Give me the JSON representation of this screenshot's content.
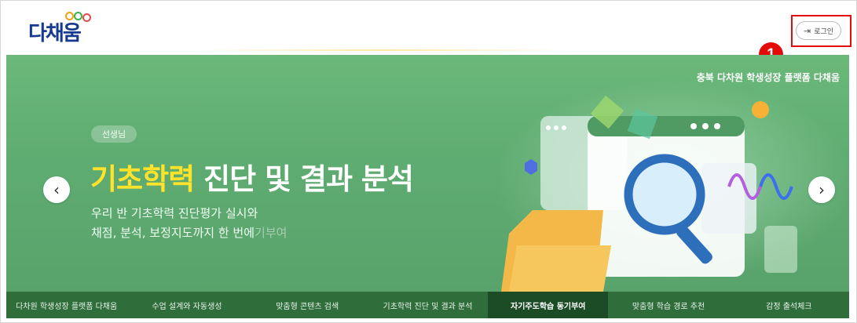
{
  "header": {
    "logo_text": "다채움",
    "login_label": "로그인",
    "login_icon": "login-arrow-icon"
  },
  "annotation": {
    "marker_number": "1",
    "marker_color": "#e30a0a"
  },
  "banner": {
    "top_caption": "충북 다차원 학생성장 플랫폼 다채움",
    "tag": "선생님",
    "headline_highlight": "기초학력",
    "headline_rest": " 진단 및 결과 분석",
    "desc_line1": "우리 반 기초학력 진단평가 실시와",
    "desc_line2": "채점, 분석, 보정지도까지 한 번에",
    "desc_line2_fade": "기부여",
    "prev_icon": "chevron-left-icon",
    "next_icon": "chevron-right-icon",
    "background_color": "#62ae74",
    "highlight_color": "#ffe32a"
  },
  "nav": {
    "items": [
      {
        "label": "다차원 학생성장 플랫폼 다채움",
        "active": false
      },
      {
        "label": "수업 설계와 자동생성",
        "active": false
      },
      {
        "label": "맞춤형 콘텐츠 검색",
        "active": false
      },
      {
        "label": "기초학력 진단 및 결과 분석",
        "active": false
      },
      {
        "label": "자기주도학습 동기부여",
        "active": true
      },
      {
        "label": "맞춤형 학습 경로 추천",
        "active": false
      },
      {
        "label": "감정 출석체크",
        "active": false
      }
    ],
    "background_color": "#2f6e3b",
    "active_color": "#1b4c26"
  }
}
